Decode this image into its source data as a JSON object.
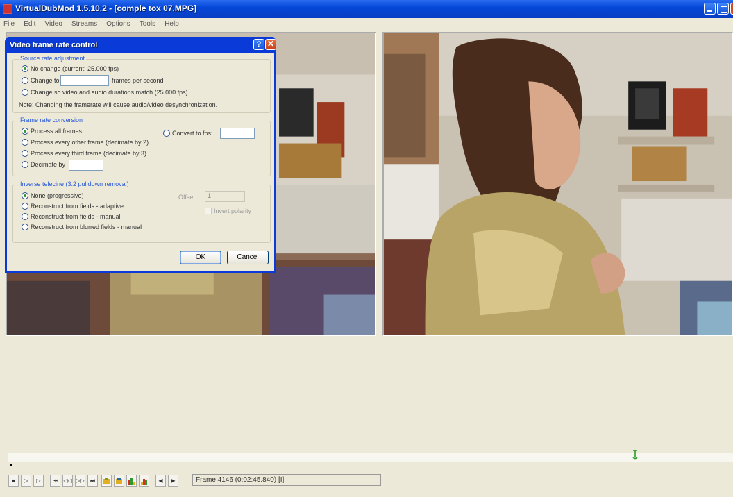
{
  "window": {
    "title": "VirtualDubMod 1.5.10.2 - [comple tox 07.MPG]",
    "minimize_label": "",
    "maximize_label": "",
    "close_label": ""
  },
  "menu": [
    "File",
    "Edit",
    "Video",
    "Streams",
    "Options",
    "Tools",
    "Help"
  ],
  "dialog": {
    "title": "Video frame rate control",
    "help_label": "?",
    "close_label": "✕",
    "source_group": {
      "legend": "Source rate adjustment",
      "no_change": "No change (current: 25.000 fps)",
      "change_to": "Change to",
      "change_to_suffix": "frames per second",
      "change_to_value": "",
      "match_audio": "Change so video and audio durations match (25.000 fps)",
      "note": "Note: Changing the framerate will cause audio/video desynchronization."
    },
    "conversion_group": {
      "legend": "Frame rate conversion",
      "process_all": "Process all frames",
      "every_other": "Process every other frame (decimate by 2)",
      "every_third": "Process every third frame (decimate by 3)",
      "decimate_by": "Decimate by",
      "decimate_value": "",
      "convert_to": "Convert to fps:",
      "convert_value": ""
    },
    "telecine_group": {
      "legend": "Inverse telecine (3:2 pulldown removal)",
      "none": "None (progressive)",
      "adaptive": "Reconstruct from fields - adaptive",
      "manual": "Reconstruct from fields - manual",
      "blurred": "Reconstruct from blurred fields - manual",
      "offset_label": "Offset:",
      "offset_value": "1",
      "invert_polarity": "Invert polarity"
    },
    "ok_label": "OK",
    "cancel_label": "Cancel"
  },
  "transport": {
    "buttons": [
      "⏹",
      "▷",
      "▷",
      "⏮",
      "◁◁",
      "▷▷",
      "⏭",
      "",
      "",
      "",
      "",
      "◀",
      "▶"
    ],
    "frame_text": "Frame 4146 (0:02:45.840) [I]"
  },
  "selection": {
    "color_green": "#2c9a2c",
    "accent": "#0a3bd8"
  }
}
